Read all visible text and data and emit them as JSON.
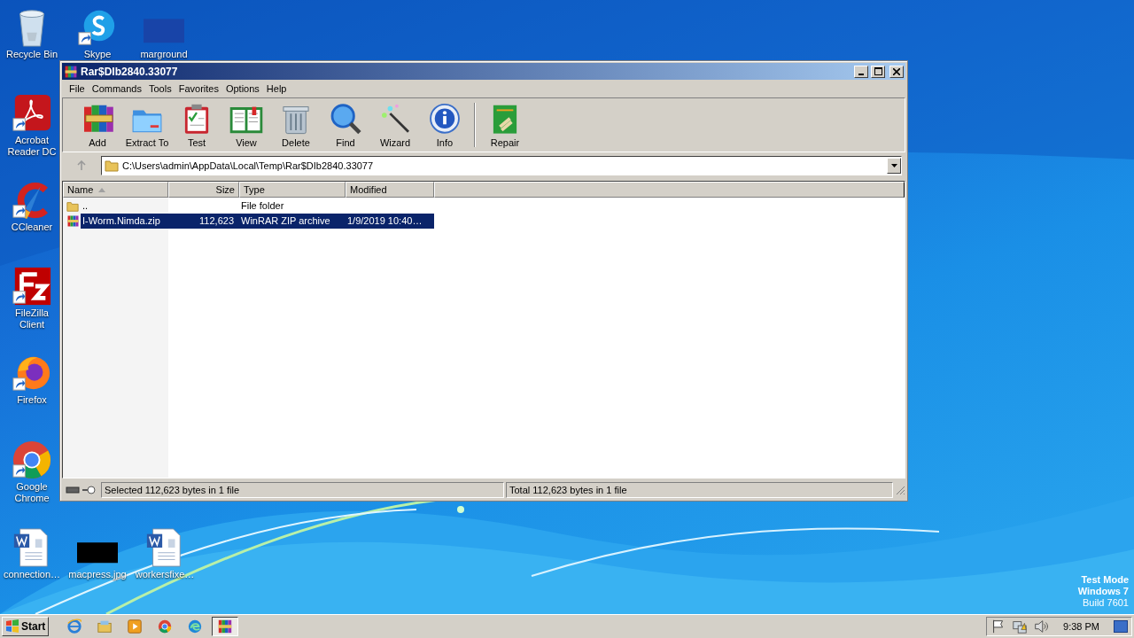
{
  "desktop_icons": [
    {
      "label": "Recycle Bin",
      "kind": "recycle",
      "shortcut": false
    },
    {
      "label": "Skype",
      "kind": "skype",
      "shortcut": true
    },
    {
      "label": "marground",
      "kind": "dark-image",
      "shortcut": false
    },
    {
      "label": "Acrobat Reader DC",
      "kind": "acrobat",
      "shortcut": true
    },
    {
      "label": "CCleaner",
      "kind": "ccleaner",
      "shortcut": true
    },
    {
      "label": "FileZilla Client",
      "kind": "filezilla",
      "shortcut": true
    },
    {
      "label": "Firefox",
      "kind": "firefox",
      "shortcut": true
    },
    {
      "label": "Google Chrome",
      "kind": "chrome",
      "shortcut": true
    },
    {
      "label": "connection…",
      "kind": "word",
      "shortcut": false
    },
    {
      "label": "macpress.jpg",
      "kind": "black-image",
      "shortcut": false
    },
    {
      "label": "workersfixe…",
      "kind": "word",
      "shortcut": false
    }
  ],
  "window": {
    "title": "Rar$DIb2840.33077",
    "menu": [
      "File",
      "Commands",
      "Tools",
      "Favorites",
      "Options",
      "Help"
    ],
    "toolbar": {
      "main": [
        {
          "label": "Add",
          "kind": "add"
        },
        {
          "label": "Extract To",
          "kind": "extract"
        },
        {
          "label": "Test",
          "kind": "test"
        },
        {
          "label": "View",
          "kind": "view"
        },
        {
          "label": "Delete",
          "kind": "delete"
        },
        {
          "label": "Find",
          "kind": "find"
        },
        {
          "label": "Wizard",
          "kind": "wizard"
        },
        {
          "label": "Info",
          "kind": "info"
        }
      ],
      "extra": [
        {
          "label": "Repair",
          "kind": "repair"
        }
      ]
    },
    "address": "C:\\Users\\admin\\AppData\\Local\\Temp\\Rar$DIb2840.33077",
    "columns": [
      {
        "label": "Name",
        "sorted": true
      },
      {
        "label": "Size",
        "sorted": false
      },
      {
        "label": "Type",
        "sorted": false
      },
      {
        "label": "Modified",
        "sorted": false
      }
    ],
    "rows": [
      {
        "name": "..",
        "size": "",
        "type": "File folder",
        "modified": "",
        "kind": "folder",
        "selected": false
      },
      {
        "name": "I-Worm.Nimda.zip",
        "size": "112,623",
        "type": "WinRAR ZIP archive",
        "modified": "1/9/2019 10:40…",
        "kind": "archive",
        "selected": true
      }
    ],
    "status_bar": {
      "left": "Selected 112,623 bytes in 1 file",
      "right": "Total 112,623 bytes in 1 file"
    }
  },
  "desktop_notice": [
    "Test Mode",
    "Windows 7",
    "Build 7601"
  ],
  "taskbar": {
    "start": "Start",
    "apps": [
      {
        "kind": "ie",
        "selected": false
      },
      {
        "kind": "explorer",
        "selected": false
      },
      {
        "kind": "media",
        "selected": false
      },
      {
        "kind": "chrome",
        "selected": false
      },
      {
        "kind": "edge",
        "selected": false
      },
      {
        "kind": "winrar",
        "selected": true
      }
    ],
    "tray": [
      {
        "kind": "flag"
      },
      {
        "kind": "network"
      },
      {
        "kind": "volume"
      }
    ],
    "time": "9:38 PM"
  }
}
